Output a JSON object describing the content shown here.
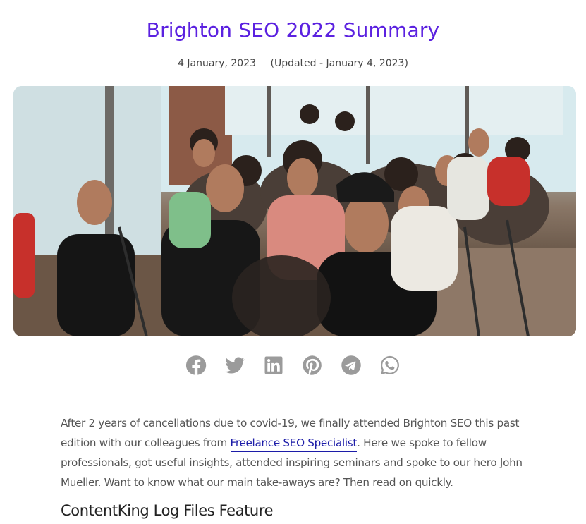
{
  "post": {
    "title": "Brighton SEO 2022 Summary",
    "date": "4 January, 2023",
    "updated": "(Updated - January 4, 2023)"
  },
  "hero_image": {
    "subject": "audience-photo"
  },
  "share": {
    "icons": [
      "facebook-icon",
      "twitter-icon",
      "linkedin-icon",
      "pinterest-icon",
      "telegram-icon",
      "whatsapp-icon"
    ],
    "color": "#9b9b9b"
  },
  "article": {
    "intro_before_link": "After 2 years of cancellations due to covid-19, we finally attended Brighton SEO this past edition with our colleagues from ",
    "link_text": "Freelance SEO Specialist",
    "intro_after_link": ". Here we spoke to fellow professionals, got useful insights, attended inspiring seminars and spoke to our hero John Mueller. Want to know what our main take-aways are? Then read on quickly.",
    "heading": "ContentKing Log Files Feature"
  },
  "colors": {
    "title": "#5b21e0",
    "link": "#1c1ca8"
  }
}
